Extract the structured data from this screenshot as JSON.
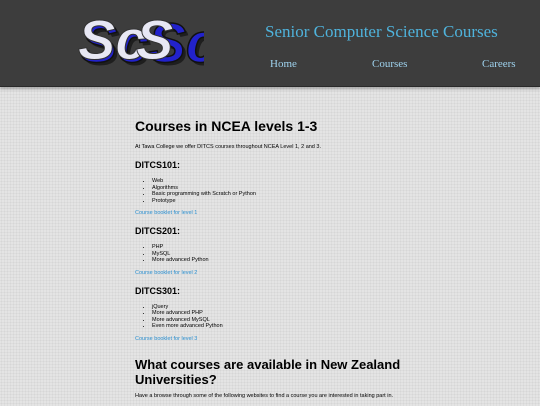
{
  "header": {
    "logo_alt": "ScSc",
    "title": "Senior Computer Science Courses",
    "nav": [
      "Home",
      "Courses",
      "Careers"
    ]
  },
  "main": {
    "heading": "Courses in NCEA levels 1-3",
    "intro": "At Tawa College we offer DITCS courses throughout NCEA Level 1, 2 and 3.",
    "courses": [
      {
        "code": "DITCS101:",
        "items": [
          "Web",
          "Algorithms",
          "Basic programming with Scratch or Python",
          "Prototype"
        ],
        "link": "Course booklet for level 1"
      },
      {
        "code": "DITCS201:",
        "items": [
          "PHP",
          "MySQL",
          "More advanced Python"
        ],
        "link": "Course booklet for level 2"
      },
      {
        "code": "DITCS301:",
        "items": [
          "jQuery",
          "More advanced PHP",
          "More advanced MySQL",
          "Even more advanced Python"
        ],
        "link": "Course booklet for level 3"
      }
    ],
    "uni_heading": "What courses are available in New Zealand Universities?",
    "uni_intro": "Have a browse through some of the following websites to find a course you are interested in taking part in."
  },
  "colors": {
    "header_bg": "#3d3d3d",
    "title": "#4fb3dc",
    "link": "#2a8fd0",
    "logo_blue": "#2222cc"
  }
}
